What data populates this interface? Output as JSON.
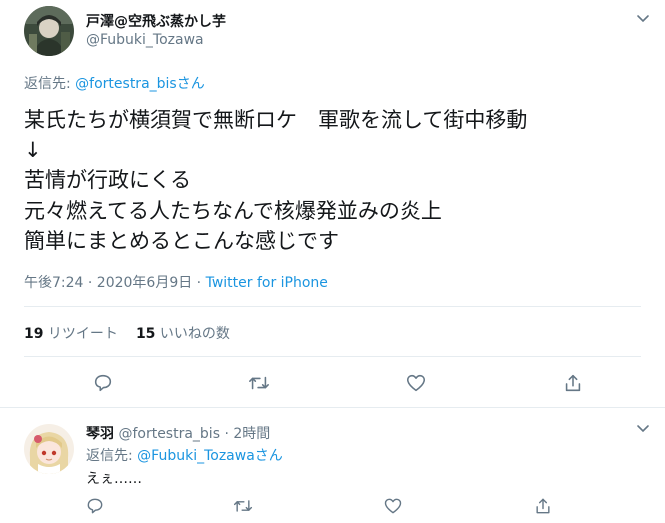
{
  "main_tweet": {
    "display_name": "戸澤@空飛ぶ蒸かし芋",
    "handle": "@Fubuki_Tozawa",
    "reply_prefix": "返信先: ",
    "reply_handle": "@fortestra_bis",
    "reply_suffix": "さん",
    "text_lines": [
      "某氏たちが横須賀で無断ロケ　軍歌を流して街中移動",
      "↓",
      "苦情が行政にくる",
      "元々燃えてる人たちなんで核爆発並みの炎上",
      "簡単にまとめるとこんな感じです"
    ],
    "timestamp": "午後7:24 · 2020年6月9日 · ",
    "source": "Twitter for iPhone",
    "retweet_count": "19",
    "retweet_label": " リツイート",
    "like_count": "15",
    "like_label": " いいねの数"
  },
  "reply_tweet": {
    "display_name": "琴羽",
    "handle": " @fortestra_bis",
    "time": " · 2時間",
    "reply_prefix": "返信先: ",
    "reply_handle": "@Fubuki_Tozawa",
    "reply_suffix": "さん",
    "text": "えぇ……"
  },
  "icons": {
    "caret": "chevron-down-icon",
    "reply": "reply-icon",
    "retweet": "retweet-icon",
    "like": "heart-icon",
    "share": "share-icon"
  },
  "colors": {
    "link": "#1b95e0",
    "secondary_text": "#657786",
    "primary_text": "#14171a",
    "divider": "#e6ecf0"
  }
}
